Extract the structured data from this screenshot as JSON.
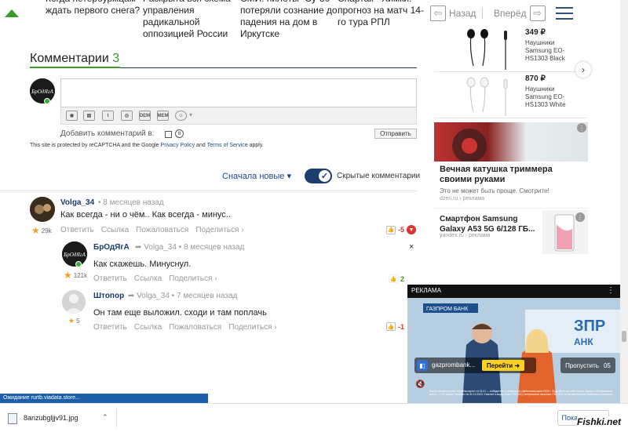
{
  "top_news": [
    "Когда петербуржцам ждать первого снега?",
    "Раскрыта вся схема управления радикальной оппозицией России",
    "СМИ: пилоты \"Су-30\" потеряли сознание до падения на дом в Иркутске",
    "Спартак - Химки: прогноз на матч 14-го тура РПЛ"
  ],
  "nav": {
    "back": "Назад",
    "forward": "Вперёд"
  },
  "products": [
    {
      "price": "349 ₽",
      "name": "Наушники Samsung EO-HS1303 Black"
    },
    {
      "price": "870 ₽",
      "name": "Наушники Samsung EO-HS1303 White"
    }
  ],
  "comments_section": {
    "title": "Комментарии",
    "count": "3",
    "add_comment_label": "Добавить комментарий в:",
    "submit": "Отправить",
    "recaptcha_pre": "This site is protected by reCAPTCHA and the Google ",
    "privacy": "Privacy Policy",
    "and": " and ",
    "terms": "Terms of Service",
    "apply": " apply.",
    "sort": "Сначала новые",
    "hidden_comments": "Скрытые комментарии",
    "toolbar": {
      "dem": "DEM",
      "mem": "MEM"
    }
  },
  "comments": [
    {
      "user": "Volga_34",
      "time": "8 месяцев назад",
      "text": "Как всегда - ни о чём.. Как всегда - минус..",
      "karma": "29k",
      "votes": "-5",
      "actions": [
        "Ответить",
        "Ссылка",
        "Пожаловаться",
        "Поделиться ›"
      ]
    },
    {
      "user": "БрОдЯгА",
      "reply_to": "Volga_34",
      "time": "8 месяцев назад",
      "text": "Как скажешь. Минуснул.",
      "karma": "121k",
      "votes": "2",
      "close": "×",
      "actions": [
        "Ответить",
        "Ссылка",
        "Поделиться ›"
      ]
    },
    {
      "user": "Штопор",
      "reply_to": "Volga_34",
      "time": "7 месяцев назад",
      "text": "Он там еще выложил. сходи и там поплачь",
      "karma": "5",
      "votes": "-1",
      "actions": [
        "Ответить",
        "Ссылка",
        "Пожаловаться",
        "Поделиться ›"
      ]
    }
  ],
  "ads": [
    {
      "title": "Вечная катушка триммера своими руками",
      "sub": "Это не может быть проще. Смотрите!",
      "src": "dzen.ru › реклама"
    },
    {
      "title": "Смартфон Samsung Galaxy A53 5G 6/128 ГБ...",
      "src": "yandex.ru › реклама"
    }
  ],
  "video_ad": {
    "label": "РЕКЛАМА",
    "brand": "gazprombank...",
    "cta": "Перейти ➜",
    "skip": "Пропустить",
    "skip_count": "05",
    "logo": "ГАЗПРОМ БАНК",
    "wall_text": "ЗПР\nАНК",
    "fine_print": "Карта в валюте рубль «Кэшбэк-карта» от 01.01 — победитель в номинации «Дебетовая карта 2023». Подробнее на сайте банка. Выпуск, обслуживание карты — 0 ₽. Акция «Кэшбэк» по 31.12.2023. Участие в акции. Банк ГПБ (АО), генеральная лицензия ГПБ (АО) на осуществление банковских операций"
  },
  "status": "Ожидание rurtb.viadata.store...",
  "download": {
    "file": "8anzubgljjv91.jpg",
    "show_all": "Показать все"
  },
  "watermark": "Fishki.net"
}
